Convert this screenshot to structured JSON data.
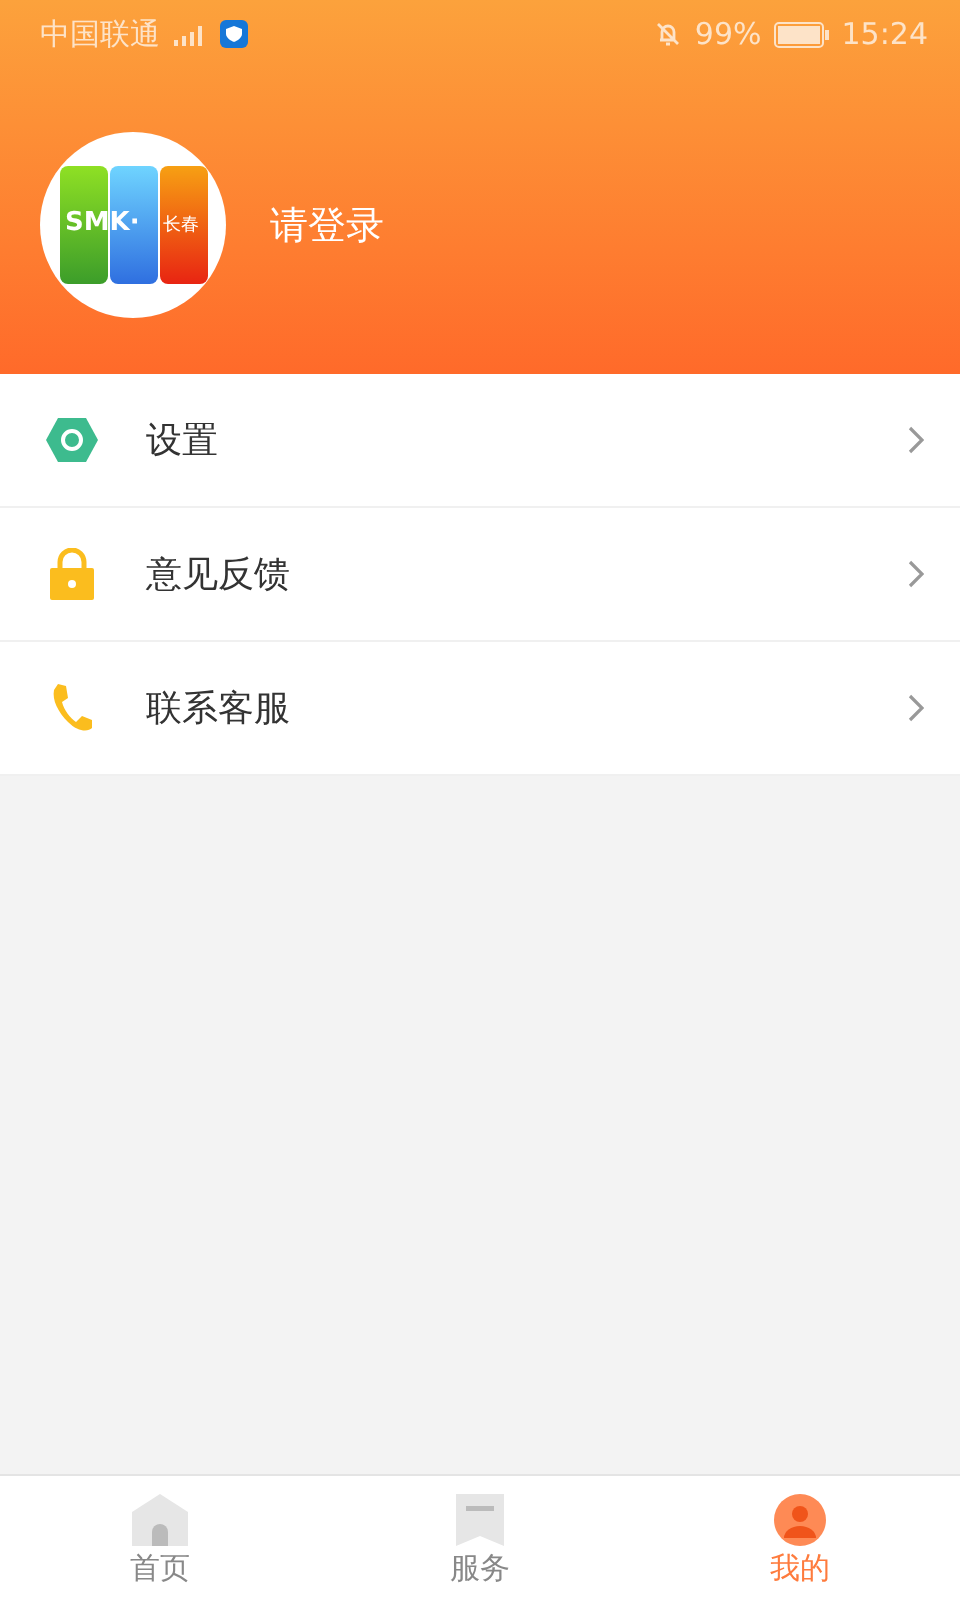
{
  "status_bar": {
    "carrier": "中国联通",
    "battery": "99%",
    "time": "15:24"
  },
  "profile": {
    "logo_text": "SMK·",
    "logo_city": "长春",
    "login": "请登录"
  },
  "menu": [
    {
      "kind": "settings",
      "label": "设置"
    },
    {
      "kind": "lock",
      "label": "意见反馈"
    },
    {
      "kind": "phone",
      "label": "联系客服"
    }
  ],
  "tabs": [
    {
      "kind": "home",
      "label": "首页",
      "selected": false
    },
    {
      "kind": "service",
      "label": "服务",
      "selected": false
    },
    {
      "kind": "me",
      "label": "我的",
      "selected": true
    }
  ]
}
